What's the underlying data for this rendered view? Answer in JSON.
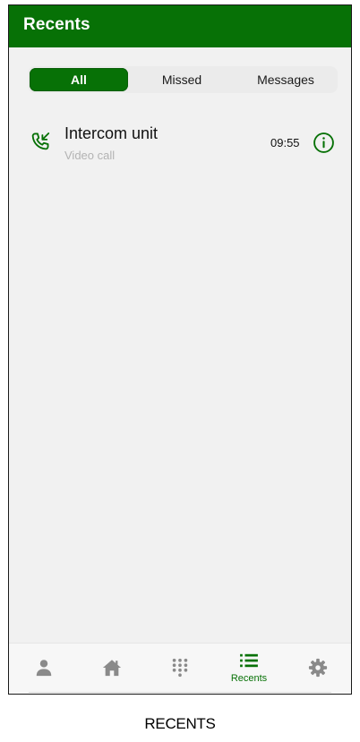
{
  "header": {
    "title": "Recents"
  },
  "tabs": [
    {
      "label": "All",
      "active": true
    },
    {
      "label": "Missed",
      "active": false
    },
    {
      "label": "Messages",
      "active": false
    }
  ],
  "calls": [
    {
      "name": "Intercom unit",
      "type": "Video call",
      "time": "09:55",
      "direction_icon": "incoming-call-icon",
      "action_icon": "info-icon"
    }
  ],
  "navbar": {
    "items": [
      {
        "icon": "person-icon",
        "label": ""
      },
      {
        "icon": "home-icon",
        "label": ""
      },
      {
        "icon": "dialpad-icon",
        "label": ""
      },
      {
        "icon": "list-icon",
        "label": "Recents",
        "active": true
      },
      {
        "icon": "gear-icon",
        "label": ""
      }
    ]
  },
  "caption": "RECENTS",
  "colors": {
    "brand": "#077106",
    "background": "#f1f1f1",
    "inactive_icon": "#8a8a8a"
  }
}
